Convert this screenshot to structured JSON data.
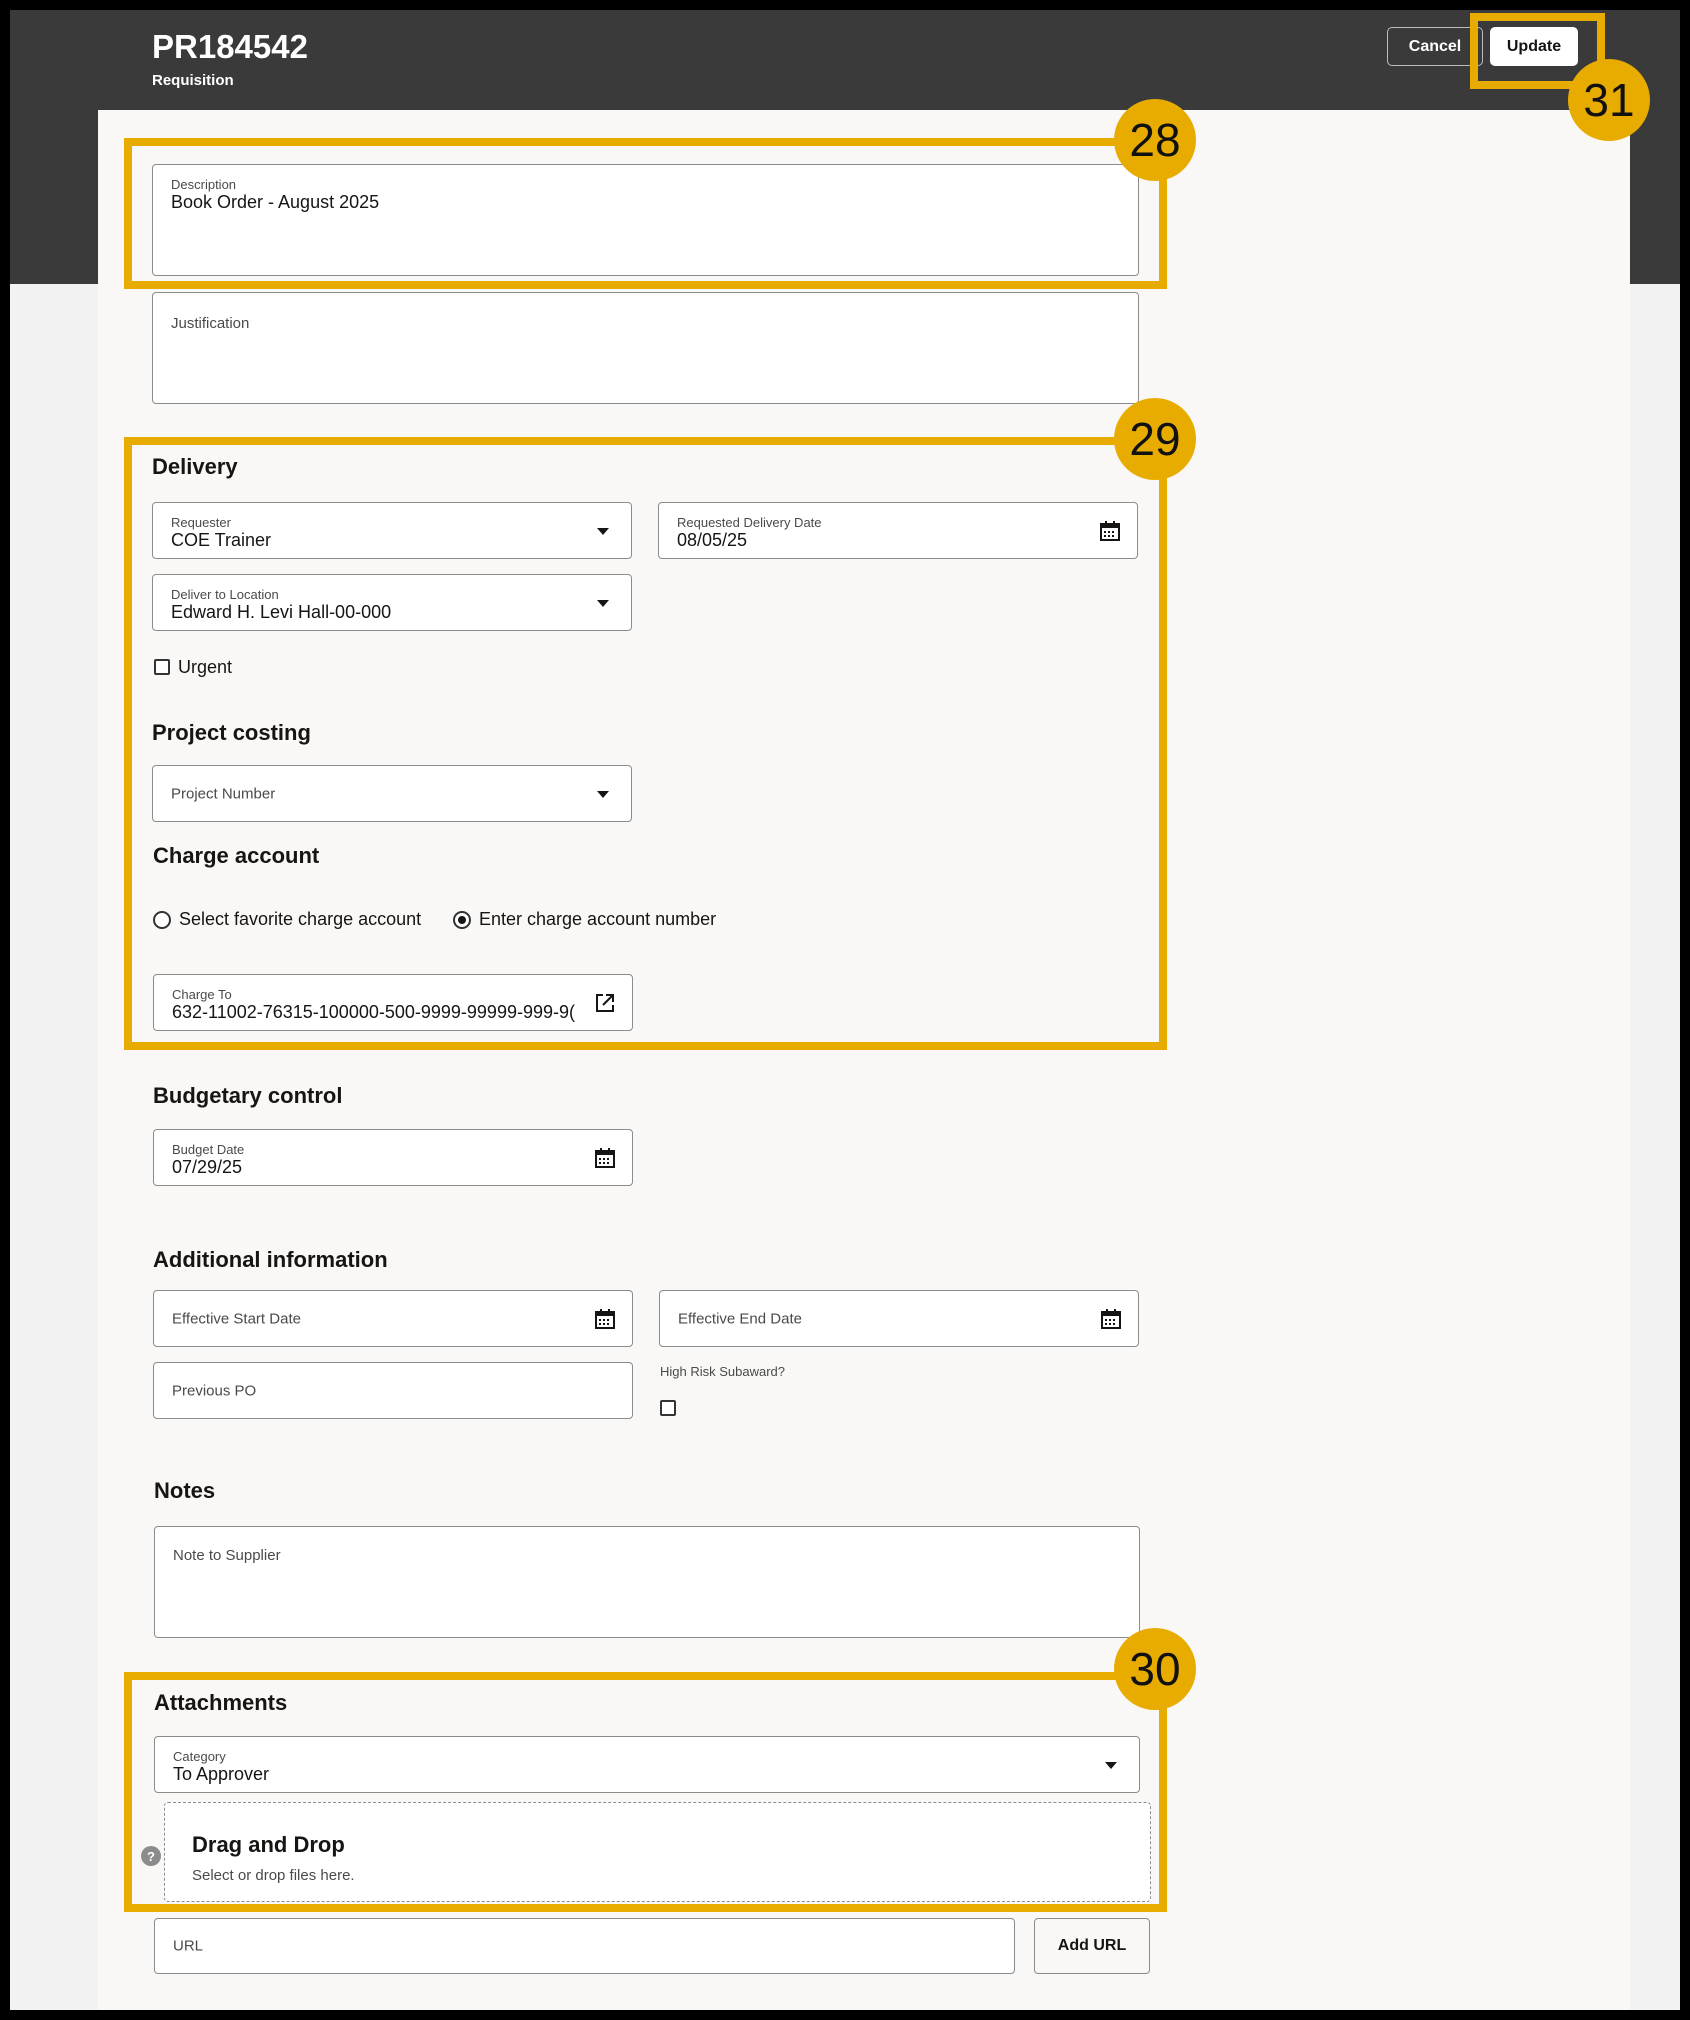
{
  "header": {
    "title": "PR184542",
    "subtitle": "Requisition",
    "cancel_label": "Cancel",
    "update_label": "Update"
  },
  "form": {
    "description": {
      "label": "Description",
      "value": "Book Order - August 2025"
    },
    "justification": {
      "placeholder": "Justification"
    },
    "delivery": {
      "heading": "Delivery",
      "requester": {
        "label": "Requester",
        "value": "COE Trainer"
      },
      "requested_delivery_date": {
        "label": "Requested Delivery Date",
        "value": "08/05/25"
      },
      "deliver_to_location": {
        "label": "Deliver to Location",
        "value": "Edward H. Levi Hall-00-000"
      },
      "urgent_label": "Urgent"
    },
    "project_costing": {
      "heading": "Project costing",
      "project_number": {
        "placeholder": "Project Number"
      }
    },
    "charge_account": {
      "heading": "Charge account",
      "option_favorite": "Select favorite charge account",
      "option_enter": "Enter charge account number",
      "selected": "Enter charge account number",
      "charge_to": {
        "label": "Charge To",
        "value": "632-11002-76315-100000-500-9999-99999-999-9("
      }
    },
    "budgetary_control": {
      "heading": "Budgetary control",
      "budget_date": {
        "label": "Budget Date",
        "value": "07/29/25"
      }
    },
    "additional_information": {
      "heading": "Additional information",
      "effective_start_date": {
        "placeholder": "Effective Start Date"
      },
      "effective_end_date": {
        "placeholder": "Effective End Date"
      },
      "previous_po": {
        "placeholder": "Previous PO"
      },
      "high_risk_subaward_label": "High Risk Subaward?"
    },
    "notes": {
      "heading": "Notes",
      "note_to_supplier": {
        "placeholder": "Note to Supplier"
      }
    },
    "attachments": {
      "heading": "Attachments",
      "category": {
        "label": "Category",
        "value": "To Approver"
      },
      "dropzone_title": "Drag and Drop",
      "dropzone_subtitle": "Select or drop files here.",
      "help_glyph": "?",
      "url": {
        "placeholder": "URL"
      },
      "add_url_label": "Add URL"
    }
  },
  "callouts": [
    {
      "number": "28"
    },
    {
      "number": "29"
    },
    {
      "number": "30"
    },
    {
      "number": "31"
    }
  ],
  "colors": {
    "header_bg": "#3a3a3a",
    "callout": "#e8ac00",
    "card_bg": "#f9f8f6"
  }
}
